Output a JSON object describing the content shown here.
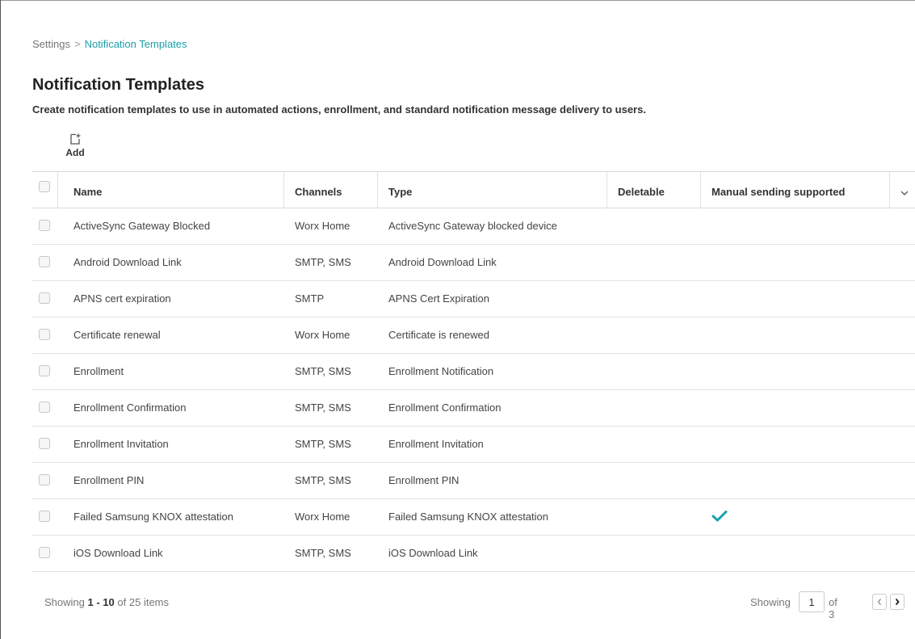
{
  "breadcrumb": {
    "parent": "Settings",
    "separator": ">",
    "current": "Notification Templates"
  },
  "page": {
    "title": "Notification Templates",
    "description": "Create notification templates to use in automated actions, enrollment, and standard notification message delivery to users."
  },
  "toolbar": {
    "add_label": "Add",
    "add_icon": "add-document-icon"
  },
  "table": {
    "headers": {
      "name": "Name",
      "channels": "Channels",
      "type": "Type",
      "deletable": "Deletable",
      "manual": "Manual sending supported"
    },
    "rows": [
      {
        "name": "ActiveSync Gateway Blocked",
        "channels": "Worx Home",
        "type": "ActiveSync Gateway blocked device",
        "manual": false
      },
      {
        "name": "Android Download Link",
        "channels": "SMTP, SMS",
        "type": "Android Download Link",
        "manual": false
      },
      {
        "name": "APNS cert expiration",
        "channels": "SMTP",
        "type": "APNS Cert Expiration",
        "manual": false
      },
      {
        "name": "Certificate renewal",
        "channels": "Worx Home",
        "type": "Certificate is renewed",
        "manual": false
      },
      {
        "name": "Enrollment",
        "channels": "SMTP, SMS",
        "type": "Enrollment Notification",
        "manual": false
      },
      {
        "name": "Enrollment Confirmation",
        "channels": "SMTP, SMS",
        "type": "Enrollment Confirmation",
        "manual": false
      },
      {
        "name": "Enrollment Invitation",
        "channels": "SMTP, SMS",
        "type": "Enrollment Invitation",
        "manual": false
      },
      {
        "name": "Enrollment PIN",
        "channels": "SMTP, SMS",
        "type": "Enrollment PIN",
        "manual": false
      },
      {
        "name": "Failed Samsung KNOX attestation",
        "channels": "Worx Home",
        "type": "Failed Samsung KNOX attestation",
        "manual": true
      },
      {
        "name": "iOS Download Link",
        "channels": "SMTP, SMS",
        "type": "iOS Download Link",
        "manual": false
      }
    ]
  },
  "footer": {
    "showing_prefix": "Showing",
    "range": "1 - 10",
    "of_word": "of",
    "total": "25",
    "items_word": "items",
    "page_label": "Showing",
    "current_page": "1",
    "of_pages": "of 3"
  },
  "colors": {
    "accent": "#1aa1a8",
    "check": "#1aa1a8"
  }
}
